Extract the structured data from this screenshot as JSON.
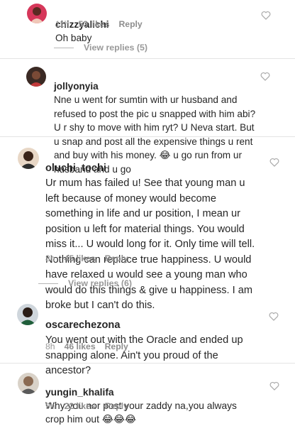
{
  "comments": [
    {
      "username": "chizzyalichi",
      "text": "Oh baby",
      "time": "11h",
      "likes": "53 likes",
      "reply": "Reply"
    },
    {
      "username": "jollyonyia",
      "text": "Nne u went for sumtin with ur husband and refused to post the pic u snapped with him abi? U r shy to move with him ryt? U Neva start. But u snap and post all the expensive things u rent and buy with his money. 😂 u go run from ur husband and u go"
    },
    {
      "username": "oluchi_tochi",
      "text": "Ur mum has failed u! See that young man u left because of money would become something in life and ur position, I mean ur position u left for material things. You would miss it... U would long for it. Only time will tell. Nothing can replace true happiness. U would have relaxed u would see a young man who would do this things & give u happiness. I am broke but I can't do this.",
      "time": "8h",
      "likes": "45 likes",
      "reply": "Reply"
    },
    {
      "username": "oscarechezona",
      "text": "You went out with the Oracle and ended up snapping alone. Ain't you proud of the ancestor?",
      "time": "8h",
      "likes": "46 likes",
      "reply": "Reply"
    },
    {
      "username": "yungin_khalifa",
      "text": "Why you nor post your zaddy na,you always crop him out 😂😂😂",
      "time": "9h",
      "likes": "22 likes",
      "reply": "Reply"
    }
  ],
  "view_replies": [
    "View replies (5)",
    "View replies (6)"
  ],
  "icons": {
    "like": "heart-outline-icon"
  },
  "colors": {
    "text": "#262626",
    "muted": "#8e8e8e",
    "heart": "#a8a8a8"
  }
}
